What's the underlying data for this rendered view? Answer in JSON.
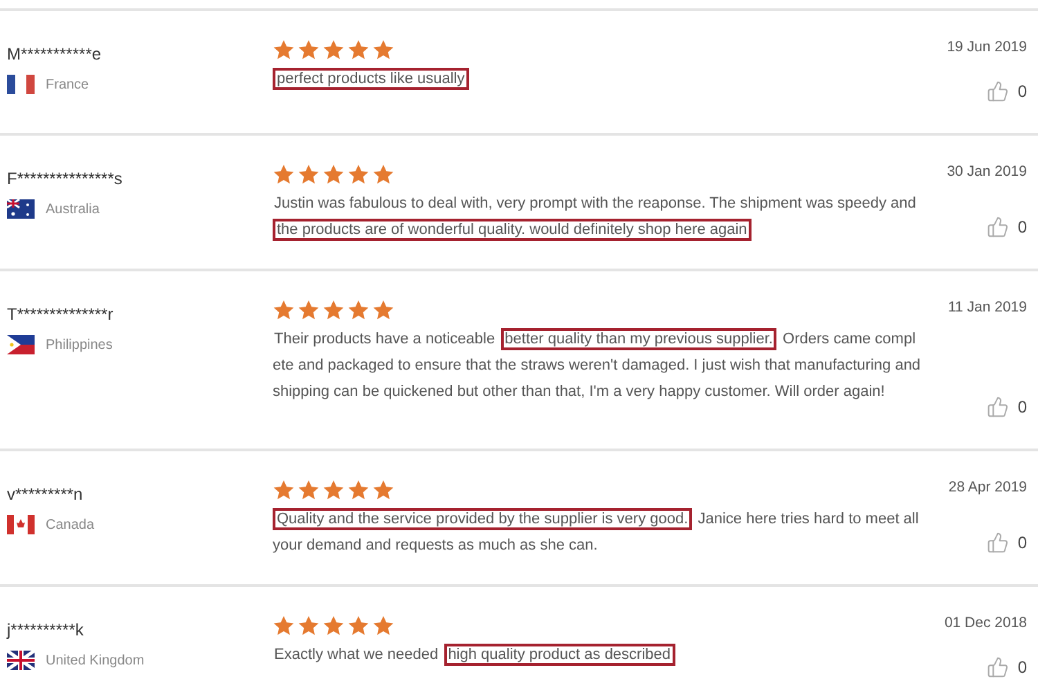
{
  "reviews": [
    {
      "name": "M***********e",
      "country": "France",
      "stars": 5,
      "date": "19 Jun 2019",
      "likes": "0",
      "text": [
        {
          "text": "perfect products like usually",
          "highlighted": true
        }
      ]
    },
    {
      "name": "F***************s",
      "country": "Australia",
      "stars": 5,
      "date": "30 Jan 2019",
      "likes": "0",
      "text": [
        {
          "text": "Justin was fabulous to deal with, very prompt with the reaponse. The shipment was speedy and ",
          "highlighted": false
        },
        {
          "text": "the products are of wonderful quality. would definitely shop here again",
          "highlighted": true
        }
      ]
    },
    {
      "name": "T**************r",
      "country": "Philippines",
      "stars": 5,
      "date": "11 Jan 2019",
      "likes": "0",
      "text": [
        {
          "text": "Their products have a noticeable ",
          "highlighted": false
        },
        {
          "text": "better quality than my previous supplier.",
          "highlighted": true
        },
        {
          "text": " Orders came complete and packaged to ensure that the straws weren't damaged. I just wish that manufacturing and shipping can be quickened but other than that, I'm a very happy customer. Will order again!",
          "highlighted": false
        }
      ]
    },
    {
      "name": "v*********n",
      "country": "Canada",
      "stars": 5,
      "date": "28 Apr 2019",
      "likes": "0",
      "text": [
        {
          "text": "Quality and the service provided by the supplier is very good.",
          "highlighted": true
        },
        {
          "text": " Janice here tries hard to meet all your demand and requests as much as she can.",
          "highlighted": false
        }
      ]
    },
    {
      "name": "j**********k",
      "country": "United Kingdom",
      "stars": 5,
      "date": "01 Dec 2018",
      "likes": "0",
      "text": [
        {
          "text": "Exactly what we needed ",
          "highlighted": false
        },
        {
          "text": "high quality product as described",
          "highlighted": true
        }
      ]
    }
  ]
}
